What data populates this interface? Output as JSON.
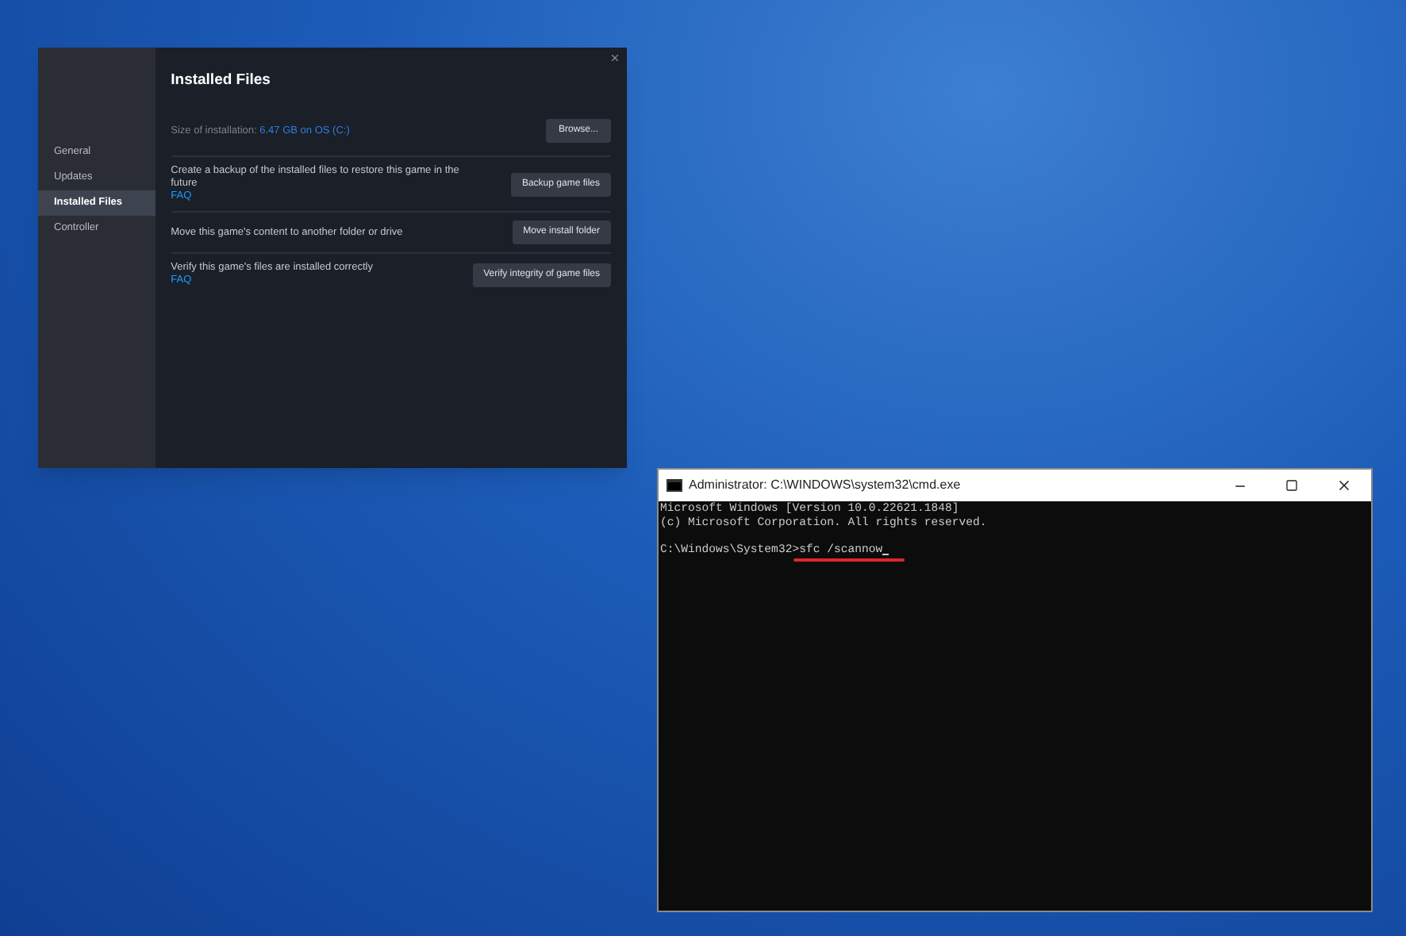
{
  "settings_window": {
    "title": "Installed Files",
    "sidebar": [
      {
        "label": "General",
        "selected": false
      },
      {
        "label": "Updates",
        "selected": false
      },
      {
        "label": "Installed Files",
        "selected": true
      },
      {
        "label": "Controller",
        "selected": false
      }
    ],
    "size": {
      "label": "Size of installation:",
      "value": "6.47 GB on OS (C:)",
      "button": "Browse..."
    },
    "rows": [
      {
        "text": "Create a backup of the installed files to restore this game in the future",
        "link": "FAQ",
        "button": "Backup game files"
      },
      {
        "text": "Move this game's content to another folder or drive",
        "button": "Move install folder"
      },
      {
        "text": "Verify this game's files are installed correctly",
        "link": "FAQ",
        "button": "Verify integrity of game files"
      }
    ]
  },
  "terminal": {
    "title": "Administrator: C:\\WINDOWS\\system32\\cmd.exe",
    "lines": [
      "Microsoft Windows [Version 10.0.22621.1848]",
      "(c) Microsoft Corporation. All rights reserved."
    ],
    "prompt": "C:\\Windows\\System32>",
    "command": "sfc /scannow"
  }
}
